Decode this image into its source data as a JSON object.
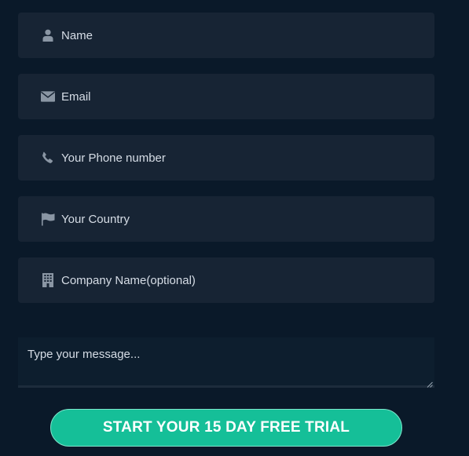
{
  "form": {
    "fields": [
      {
        "placeholder": "Name",
        "value": "",
        "icon": "user-icon"
      },
      {
        "placeholder": "Email",
        "value": "",
        "icon": "envelope-icon"
      },
      {
        "placeholder": "Your Phone number",
        "value": "",
        "icon": "phone-icon"
      },
      {
        "placeholder": "Your Country",
        "value": "",
        "icon": "flag-icon"
      },
      {
        "placeholder": "Company Name(optional)",
        "value": "",
        "icon": "building-icon"
      }
    ],
    "message": {
      "placeholder": "Type your message...",
      "value": ""
    },
    "submit_label": "START YOUR 15 DAY FREE TRIAL"
  },
  "colors": {
    "background": "#0a1929",
    "field_background": "#172434",
    "accent": "#15bf98",
    "text": "#d6dde6",
    "icon": "#8a96a4"
  }
}
